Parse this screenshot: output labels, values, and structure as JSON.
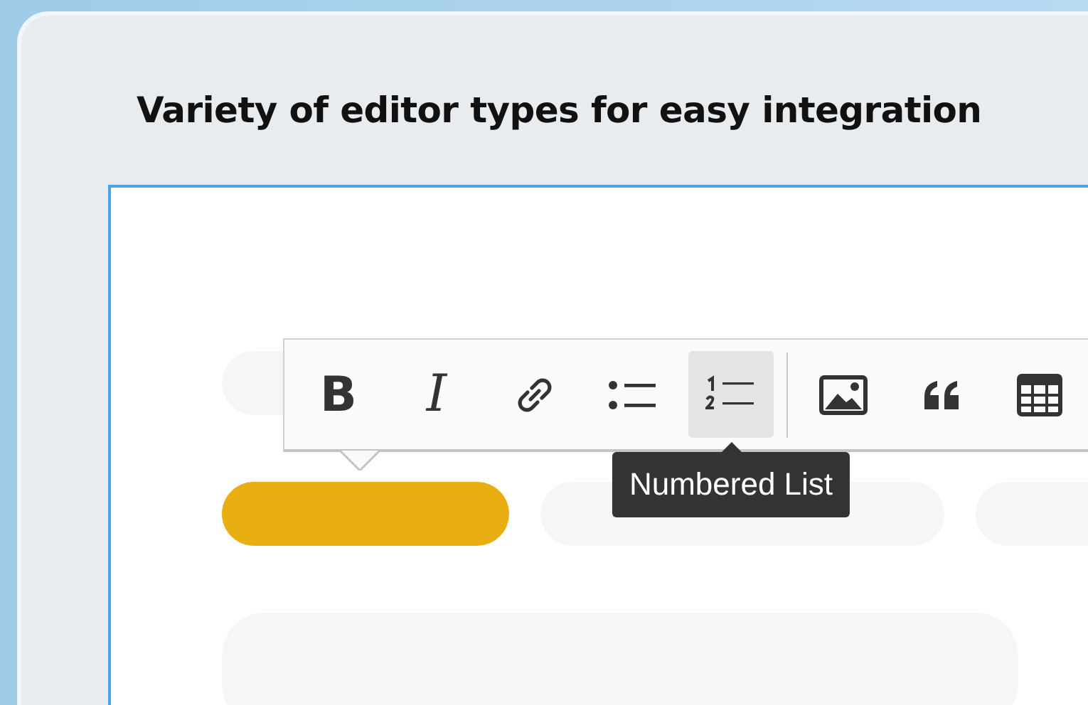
{
  "title": "Variety of editor types for easy integration",
  "toolbar": {
    "buttons": [
      {
        "kind": "bold",
        "label": "B",
        "selected": false
      },
      {
        "kind": "italic",
        "label": "I",
        "selected": false
      },
      {
        "kind": "link",
        "selected": false
      },
      {
        "kind": "bulleted_list",
        "selected": false
      },
      {
        "kind": "numbered_list",
        "selected": true,
        "tooltip": "Numbered List"
      },
      {
        "kind": "separator"
      },
      {
        "kind": "image",
        "selected": false
      },
      {
        "kind": "quote",
        "selected": false
      },
      {
        "kind": "table",
        "selected": false
      }
    ]
  },
  "content_rows": [
    [
      {
        "highlighted": false
      }
    ],
    [
      {
        "highlighted": true
      },
      {
        "highlighted": false
      },
      {
        "highlighted": false
      }
    ],
    [
      {
        "highlighted": false
      }
    ]
  ]
}
